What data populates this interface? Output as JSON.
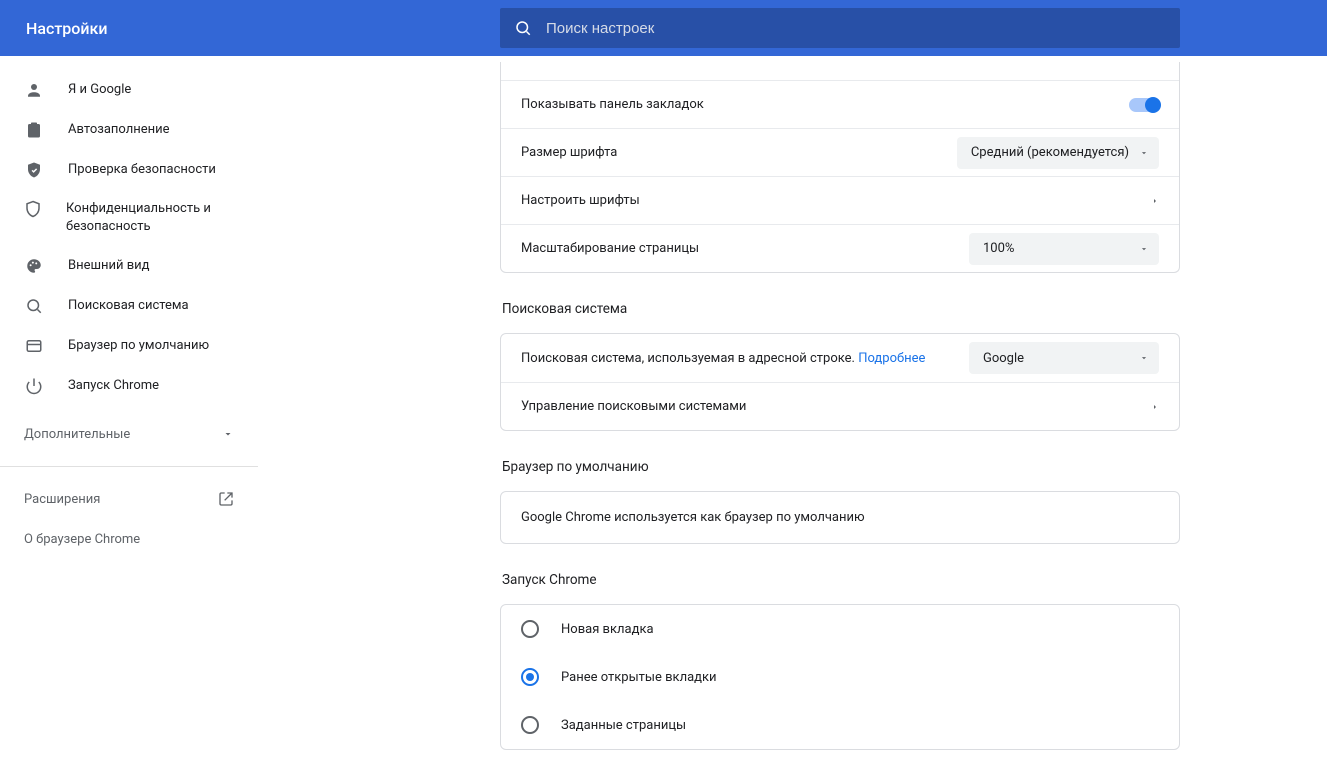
{
  "header": {
    "title": "Настройки",
    "search_placeholder": "Поиск настроек"
  },
  "sidebar": {
    "items": [
      {
        "icon": "person",
        "label": "Я и Google"
      },
      {
        "icon": "clipboard",
        "label": "Автозаполнение"
      },
      {
        "icon": "shield-check",
        "label": "Проверка безопасности"
      },
      {
        "icon": "shield",
        "label": "Конфиденциальность и безопасность"
      },
      {
        "icon": "palette",
        "label": "Внешний вид"
      },
      {
        "icon": "search",
        "label": "Поисковая система"
      },
      {
        "icon": "window",
        "label": "Браузер по умолчанию"
      },
      {
        "icon": "power",
        "label": "Запуск Chrome"
      }
    ],
    "advanced_label": "Дополнительные",
    "extensions_label": "Расширения",
    "about_label": "О браузере Chrome"
  },
  "appearance": {
    "bookmarks_label": "Показывать панель закладок",
    "bookmarks_on": true,
    "font_size_label": "Размер шрифта",
    "font_size_value": "Средний (рекомендуется)",
    "customize_fonts_label": "Настроить шрифты",
    "zoom_label": "Масштабирование страницы",
    "zoom_value": "100%"
  },
  "search_engine": {
    "section_title": "Поисковая система",
    "addressbar_label_prefix": "Поисковая система, используемая в адресной строке. ",
    "addressbar_more": "Подробнее",
    "addressbar_value": "Google",
    "manage_label": "Управление поисковыми системами"
  },
  "default_browser": {
    "section_title": "Браузер по умолчанию",
    "message": "Google Chrome используется как браузер по умолчанию"
  },
  "startup": {
    "section_title": "Запуск Chrome",
    "options": [
      {
        "label": "Новая вкладка",
        "selected": false
      },
      {
        "label": "Ранее открытые вкладки",
        "selected": true
      },
      {
        "label": "Заданные страницы",
        "selected": false
      }
    ]
  },
  "icons": {
    "search": "search-icon",
    "chevron_down": "chevron-down-icon",
    "chevron_right": "chevron-right-icon",
    "open_external": "open-external-icon"
  }
}
